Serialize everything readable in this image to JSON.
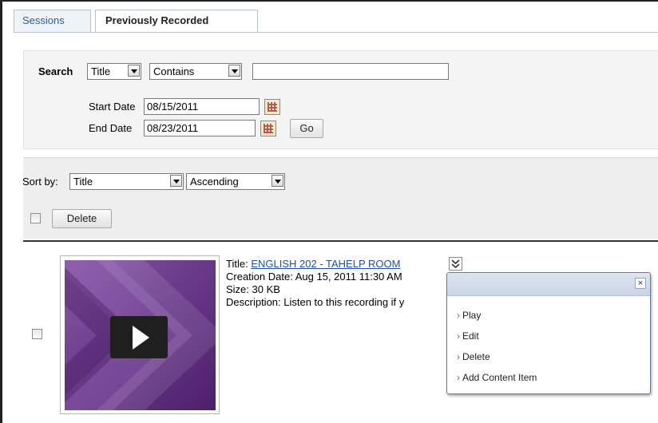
{
  "tabs": [
    {
      "label": "Sessions"
    },
    {
      "label": "Previously Recorded"
    }
  ],
  "search": {
    "label": "Search",
    "field_select": "Title",
    "operator_select": "Contains",
    "query_value": "",
    "start_date_label": "Start Date",
    "start_date_value": "08/15/2011",
    "end_date_label": "End Date",
    "end_date_value": "08/23/2011",
    "go_label": "Go"
  },
  "sort": {
    "label": "Sort by:",
    "field": "Title",
    "order": "Ascending",
    "delete_label": "Delete"
  },
  "recording": {
    "title_label": "Title:",
    "title_value": "ENGLISH 202 - TAHELP ROOM",
    "creation_line": "Creation Date: Aug 15, 2011 11:30 AM",
    "size_line": "Size: 30 KB",
    "description_line": "Description: Listen to this recording if y"
  },
  "context_menu": {
    "close": "×",
    "items": [
      "Play",
      "Edit",
      "Delete",
      "Add Content Item"
    ]
  },
  "colors": {
    "link": "#1f4e9b",
    "tab_text": "#2d5f91",
    "thumb_purple": "#6b3b8c"
  }
}
